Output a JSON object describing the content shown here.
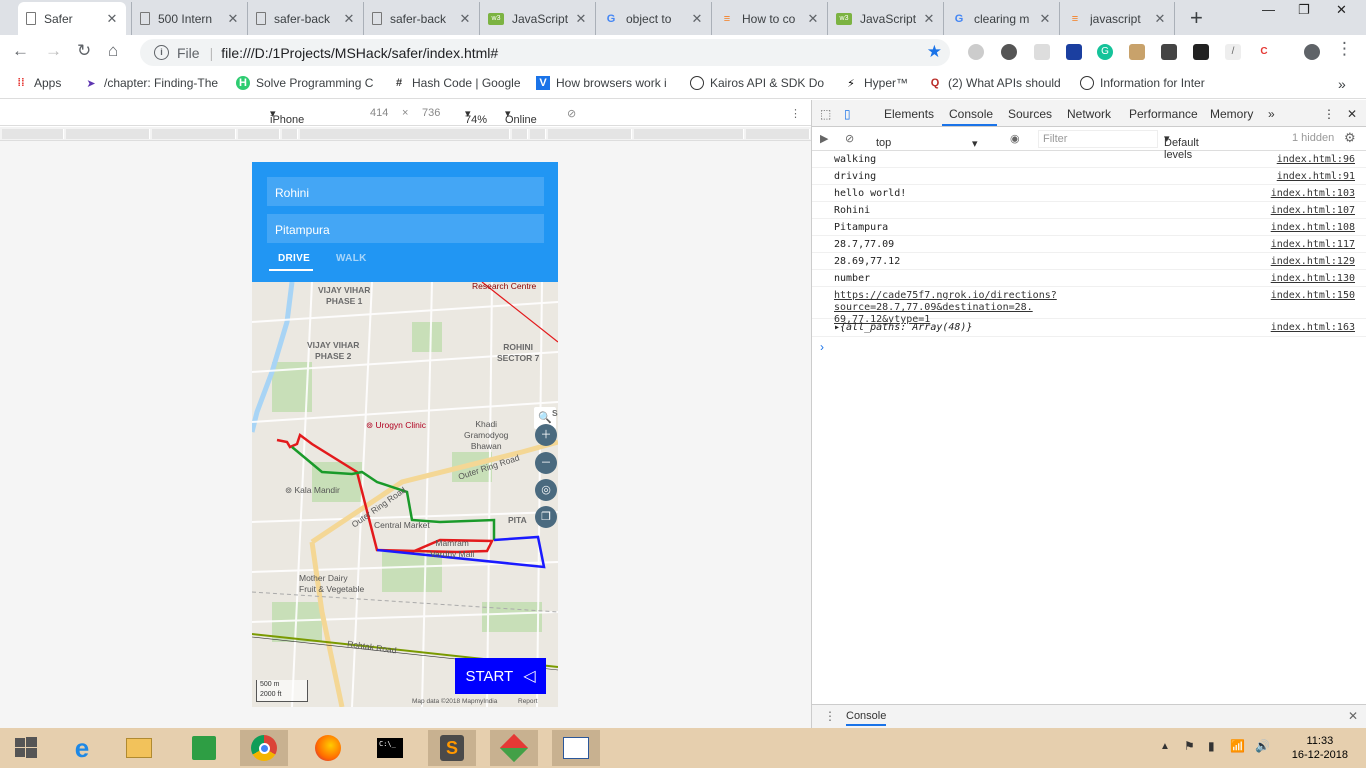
{
  "tabs": [
    {
      "title": "Safer",
      "icon": "document-icon",
      "active": true
    },
    {
      "title": "500 Intern",
      "icon": "document-icon"
    },
    {
      "title": "safer-back",
      "icon": "document-icon"
    },
    {
      "title": "safer-back",
      "icon": "document-icon"
    },
    {
      "title": "JavaScript",
      "icon": "w3-icon"
    },
    {
      "title": "object to",
      "icon": "google-icon"
    },
    {
      "title": "How to co",
      "icon": "stackoverflow-icon"
    },
    {
      "title": "JavaScript",
      "icon": "w3-icon"
    },
    {
      "title": "clearing m",
      "icon": "google-icon"
    },
    {
      "title": "javascript",
      "icon": "stackoverflow-icon"
    }
  ],
  "omnibox": {
    "scheme_label": "File",
    "url": "file:///D:/1Projects/MSHack/safer/index.html#"
  },
  "bookmarks": [
    {
      "label": "Apps",
      "icon": "apps-icon"
    },
    {
      "label": "/chapter: Finding-The",
      "icon": "arrow-bookmark-icon"
    },
    {
      "label": "Solve Programming C",
      "icon": "hackerearth-icon"
    },
    {
      "label": "Hash Code | Google",
      "icon": "hash-icon"
    },
    {
      "label": "How browsers work i",
      "icon": "v-icon"
    },
    {
      "label": "Kairos API & SDK Do",
      "icon": "kairos-icon"
    },
    {
      "label": "Hyper™",
      "icon": "hyper-icon"
    },
    {
      "label": "(2) What APIs should",
      "icon": "quora-icon"
    },
    {
      "label": "Information for Inter",
      "icon": "info-icon"
    }
  ],
  "device_toolbar": {
    "device": "iPhone 6/7/...",
    "width": "414",
    "times": "×",
    "height": "736",
    "zoom": "74%",
    "network": "Online"
  },
  "app": {
    "source_value": "Rohini",
    "destination_value": "Pitampura",
    "tab_drive": "DRIVE",
    "tab_walk": "WALK",
    "start_label": "START",
    "map_labels": {
      "research": "Research Centre",
      "vijay1": "VIJAY VIHAR\nPHASE 1",
      "vijay2": "VIJAY VIHAR\nPHASE 2",
      "rohini7": "ROHINI\nSECTOR 7",
      "urogyn": "Urogyn Clinic",
      "khadi": "Khadi\nGramodyog\nBhawan",
      "outer1": "Outer Ring Road",
      "outer2": "Outer Ring Road",
      "kala": "Kala Mandir",
      "central": "Central Market",
      "pita": "PITA",
      "mall": "Mamram\nVardhy Mall",
      "mother": "Mother Dairy\nFruit & Vegetable",
      "rohtak": "Rohtak Road",
      "s": "S",
      "scale1": "500 m",
      "scale2": "2000 ft",
      "attribution": "Map data ©2018 MapmyIndia",
      "report": "Report"
    }
  },
  "devtools": {
    "tabs": [
      "Elements",
      "Console",
      "Sources",
      "Network",
      "Performance",
      "Memory"
    ],
    "context": "top",
    "filter_placeholder": "Filter",
    "levels": "Default levels",
    "hidden": "1 hidden",
    "logs": [
      {
        "msg": "walking",
        "src": "index.html:96"
      },
      {
        "msg": "driving",
        "src": "index.html:91"
      },
      {
        "msg": "hello world!",
        "src": "index.html:103"
      },
      {
        "msg": "Rohini",
        "src": "index.html:107"
      },
      {
        "msg": "Pitampura",
        "src": "index.html:108"
      },
      {
        "msg": "28.7,77.09",
        "src": "index.html:117"
      },
      {
        "msg": "28.69,77.12",
        "src": "index.html:129"
      },
      {
        "msg": "number",
        "src": "index.html:130"
      },
      {
        "msg": "https://cade75f7.ngrok.io/directions?source=28.7,77.09&destination=28.\n69,77.12&vtype=1",
        "src": "index.html:150"
      },
      {
        "msg": "▸{all_paths: Array(48)}",
        "src": "index.html:163"
      }
    ],
    "drawer_tab": "Console"
  },
  "taskbar": {
    "time": "11:33",
    "date": "16-12-2018"
  },
  "colors": {
    "app_blue": "#2196f3",
    "start_blue": "#0000ff",
    "route_red": "#e31a1c",
    "route_green": "#1a9a2a"
  }
}
